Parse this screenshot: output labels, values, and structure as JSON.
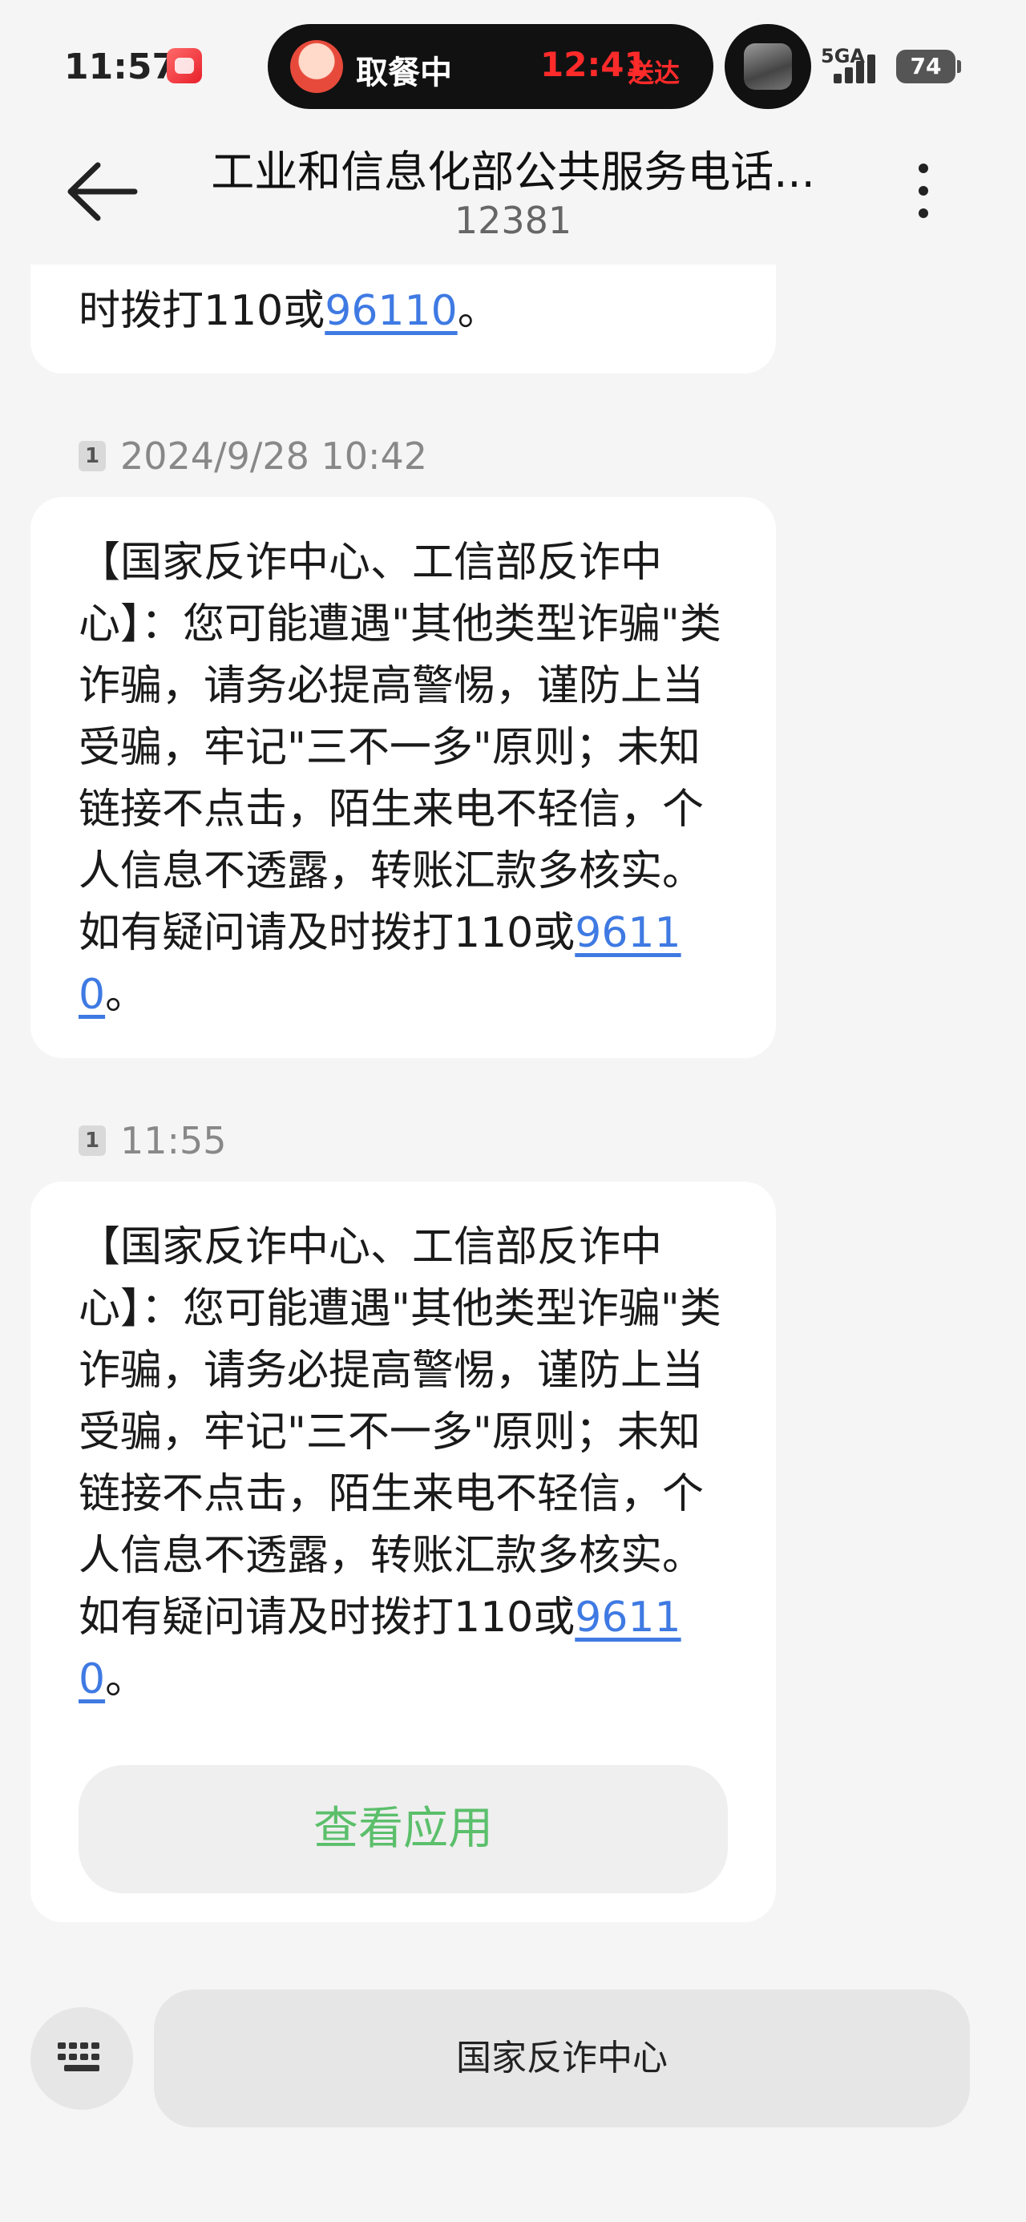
{
  "status_bar": {
    "time": "11:57",
    "island_status": "取餐中",
    "island_eta": "12:41",
    "island_eta_suffix": "送达",
    "network": "5GA",
    "battery": "74"
  },
  "header": {
    "title": "工业和信息化部公共服务电话...",
    "subtitle": "12381",
    "back_icon": "arrow-left-icon",
    "more_icon": "more-vertical-icon"
  },
  "messages": {
    "top_partial": {
      "text_before": "时拨打110或",
      "link": "96110",
      "text_after": "。"
    },
    "items": [
      {
        "sim": "1",
        "time": "2024/9/28 10:42",
        "body": "【国家反诈中心、工信部反诈中心】：您可能遭遇\"其他类型诈骗\"类诈骗，请务必提高警惕，谨防上当受骗，牢记\"三不一多\"原则；未知链接不点击，陌生来电不轻信，个人信息不透露，转账汇款多核实。如有疑问请及时拨打110或",
        "link": "96110",
        "tail": "。"
      },
      {
        "sim": "1",
        "time": "11:55",
        "body": "【国家反诈中心、工信部反诈中心】：您可能遭遇\"其他类型诈骗\"类诈骗，请务必提高警惕，谨防上当受骗，牢记\"三不一多\"原则；未知链接不点击，陌生来电不轻信，个人信息不透露，转账汇款多核实。如有疑问请及时拨打110或",
        "link": "96110",
        "tail": "。",
        "action_label": "查看应用"
      }
    ]
  },
  "bottom_bar": {
    "keyboard_icon": "keyboard-icon",
    "quick_reply": "国家反诈中心"
  },
  "colors": {
    "link": "#3f7ae3",
    "action": "#5bbf6b",
    "eta": "#ff2a2a"
  }
}
